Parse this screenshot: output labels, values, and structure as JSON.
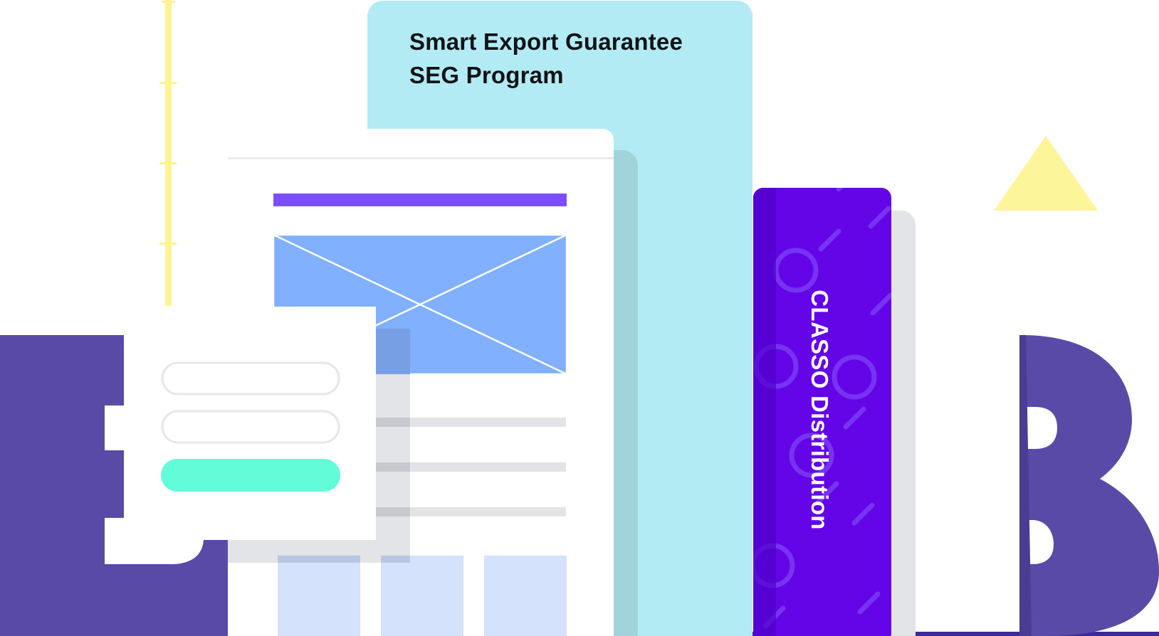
{
  "seg_card": {
    "title_line1": "Smart Export Guarantee",
    "title_line2": "SEG Program"
  },
  "classo_book": {
    "label": "CLASSO Distribution"
  },
  "colors": {
    "background": "#ffffff",
    "letter_purple": "#5a4aa8",
    "seg_card_cyan": "#b2ebf3",
    "seg_card_shadow": "#a1d4da",
    "book_violet": "#6305e6",
    "book_spine": "#5100cc",
    "header_bar_purple": "#7b4dff",
    "image_placeholder_blue": "#80b0fe",
    "form_button_mint": "#63fcd9",
    "ruler_yellow": "#fff38f",
    "triangle_yellow": "#fdf59a",
    "grid_tile_blue": "#d4e2fb"
  },
  "icons": {
    "wireframe_image": "image-placeholder-icon",
    "decorative_ruler": "ruler-icon",
    "decorative_triangle": "triangle-icon"
  }
}
